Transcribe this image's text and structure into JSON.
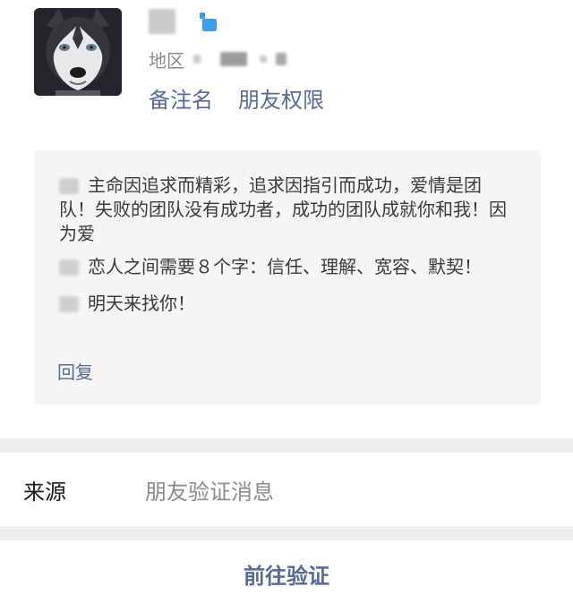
{
  "profile": {
    "region_label": "地区",
    "remark_link": "备注名",
    "permission_link": "朋友权限"
  },
  "messages": [
    {
      "text": "主命因追求而精彩，追求因指引而成功，爱情是团队！失败的团队没有成功者，成功的团队成就你和我！因为爱"
    },
    {
      "text": "恋人之间需要８个字：信任、理解、宽容、默契！"
    },
    {
      "text": "明天来找你！"
    }
  ],
  "reply_label": "回复",
  "source": {
    "label": "来源",
    "value": "朋友验证消息"
  },
  "action": {
    "label": "前往验证"
  },
  "colors": {
    "link": "#576b95",
    "separator": "#ededed",
    "card": "#f5f5f5",
    "gender_icon": "#3d9fe8"
  },
  "icons": {
    "avatar": "husky-avatar",
    "gender": "male-gender-icon"
  }
}
